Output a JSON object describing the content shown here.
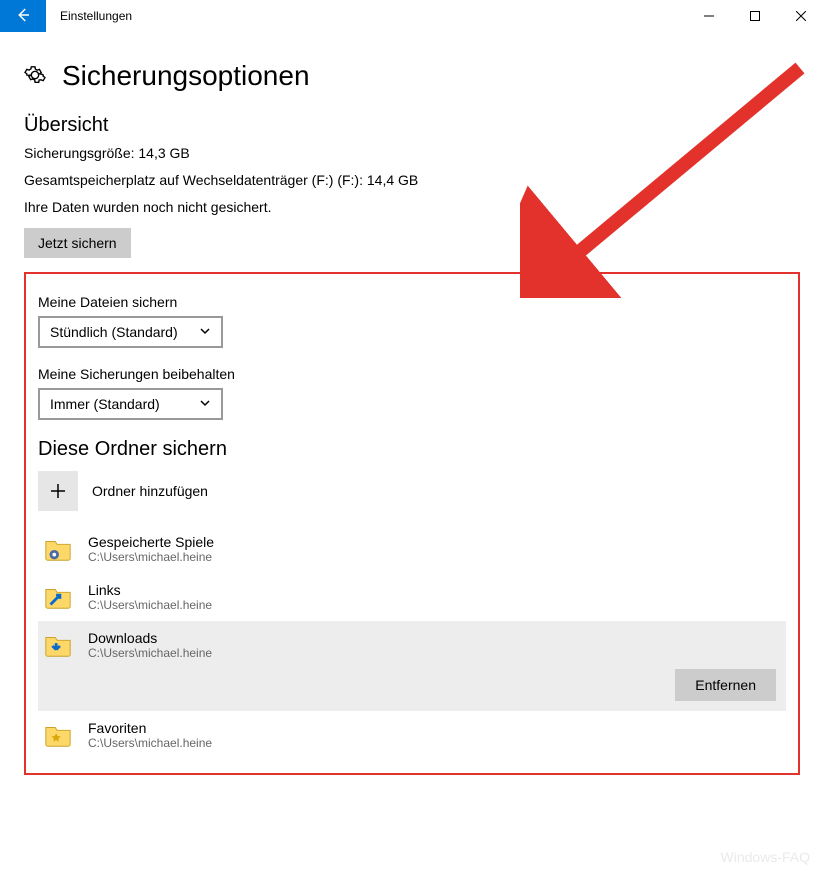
{
  "titlebar": {
    "title": "Einstellungen"
  },
  "header": {
    "page_title": "Sicherungsoptionen"
  },
  "overview": {
    "heading": "Übersicht",
    "size_line": "Sicherungsgröße: 14,3 GB",
    "storage_line": "Gesamtspeicherplatz auf Wechseldatenträger (F:) (F:): 14,4 GB",
    "status_line": "Ihre Daten wurden noch nicht gesichert.",
    "backup_now_label": "Jetzt sichern"
  },
  "frequency": {
    "label": "Meine Dateien sichern",
    "value": "Stündlich (Standard)"
  },
  "retention": {
    "label": "Meine Sicherungen beibehalten",
    "value": "Immer (Standard)"
  },
  "folders": {
    "heading": "Diese Ordner sichern",
    "add_label": "Ordner hinzufügen",
    "remove_label": "Entfernen",
    "items": [
      {
        "name": "Gespeicherte Spiele",
        "path": "C:\\Users\\michael.heine"
      },
      {
        "name": "Links",
        "path": "C:\\Users\\michael.heine"
      },
      {
        "name": "Downloads",
        "path": "C:\\Users\\michael.heine"
      },
      {
        "name": "Favoriten",
        "path": "C:\\Users\\michael.heine"
      }
    ]
  },
  "watermark": "Windows-FAQ"
}
